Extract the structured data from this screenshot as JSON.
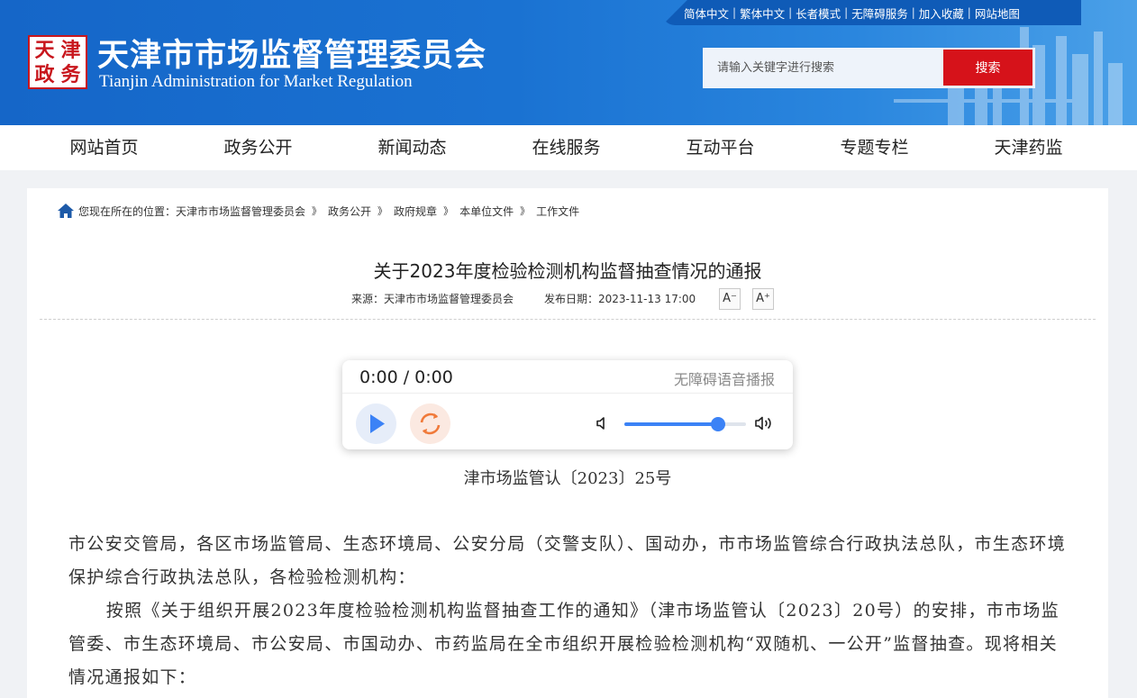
{
  "header": {
    "top_links": [
      "简体中文",
      "繁体中文",
      "长者模式",
      "无障碍服务",
      "加入收藏",
      "网站地图"
    ],
    "site_title": "天津市市场监督管理委员会",
    "site_title_en": "Tianjin Administration for Market Regulation",
    "seal_chars": [
      "天",
      "津",
      "政",
      "务"
    ],
    "search": {
      "placeholder": "请输入关键字进行搜索",
      "button": "搜索"
    }
  },
  "nav": [
    "网站首页",
    "政务公开",
    "新闻动态",
    "在线服务",
    "互动平台",
    "专题专栏",
    "天津药监"
  ],
  "breadcrumb": {
    "prefix": "您现在所在的位置：",
    "items": [
      "天津市市场监督管理委员会",
      "政务公开",
      "政府规章",
      "本单位文件",
      "工作文件"
    ],
    "separator": "》"
  },
  "article": {
    "title": "关于2023年度检验检测机构监督抽查情况的通报",
    "source": "来源：天津市市场监督管理委员会",
    "date": "发布日期：2023-11-13 17:00",
    "font_decrease": "A⁻",
    "font_increase": "A⁺",
    "doc_number": "津市场监管认〔2023〕25号",
    "paragraphs": [
      "市公安交管局，各区市场监管局、生态环境局、公安分局（交警支队）、国动办，市市场监管综合行政执法总队，市生态环境保护综合行政执法总队，各检验检测机构：",
      "按照《关于组织开展2023年度检验检测机构监督抽查工作的通知》（津市场监管认〔2023〕20号）的安排，市市场监管委、市生态环境局、市公安局、市国动办、市药监局在全市组织开展检验检测机构“双随机、一公开”监督抽查。现将相关情况通报如下："
    ]
  },
  "player": {
    "time": "0:00 / 0:00",
    "label": "无障碍语音播报",
    "volume": 0.77
  },
  "colors": {
    "header_blue": "#1a6fd0",
    "search_button_red": "#d6121a",
    "player_accent": "#3b82f6"
  }
}
